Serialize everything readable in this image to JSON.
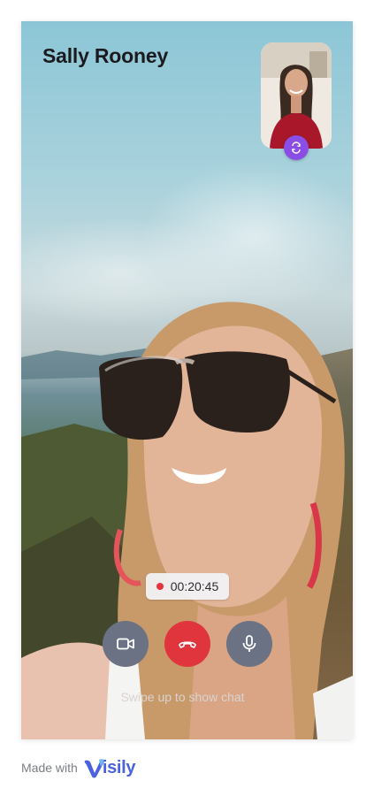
{
  "call": {
    "caller_name": "Sally Rooney",
    "timer": "00:20:45",
    "swipe_hint": "Swipe up to show chat"
  },
  "controls": {
    "video_icon": "video-camera-icon",
    "end_icon": "phone-hangup-icon",
    "mic_icon": "microphone-icon",
    "swap_icon": "swap-camera-icon"
  },
  "footer": {
    "made_with": "Made with",
    "brand": "isily",
    "brand_mark": "V"
  },
  "colors": {
    "swap_button": "#8a4de6",
    "end_call": "#e0353c",
    "control_button": "#6b7283",
    "record_dot": "#e5343d",
    "brand": "#4a63dd"
  }
}
